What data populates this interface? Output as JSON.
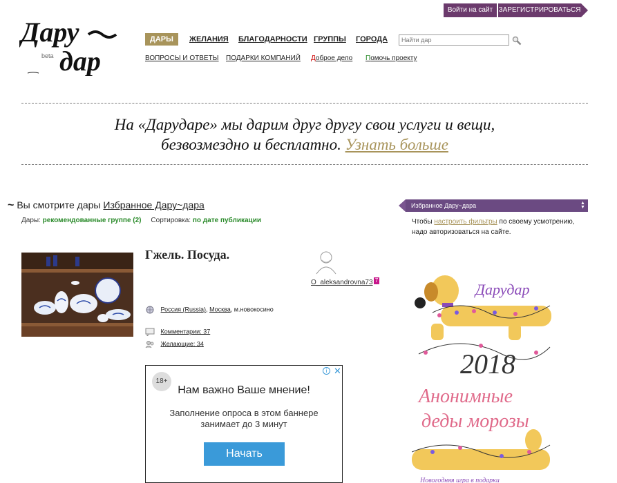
{
  "auth": {
    "login": "Войти на сайт",
    "register": "ЗАРЕГИСТРИРОВАТЬСЯ"
  },
  "logo": {
    "line1": "Дару",
    "line2": "дар",
    "beta": "beta"
  },
  "nav": {
    "primary": [
      "ДАРЫ",
      "ЖЕЛАНИЯ",
      "БЛАГОДАРНОСТИ",
      "ГРУППЫ",
      "ГОРОДА"
    ],
    "secondary": [
      "ВОПРОСЫ И ОТВЕТЫ",
      "ПОДАРКИ КОМПАНИЙ"
    ],
    "good_deed": {
      "first": "Д",
      "rest": "оброе дело"
    },
    "help": {
      "first": "П",
      "rest": "омочь проекту"
    }
  },
  "search": {
    "placeholder": "Найти дар"
  },
  "tagline": {
    "text_line1": "На «Дарударе» мы дарим друг другу свои услуги и вещи,",
    "text_line2": "безвозмездно и бесплатно.",
    "more": "Узнать больше"
  },
  "viewing": {
    "prefix": "Вы смотрите дары",
    "group": "Избранное Дару~дара"
  },
  "filters": {
    "gifts_label": "Дары:",
    "gifts_value": "рекомендованные группе (2)",
    "sort_label": "Сортировка:",
    "sort_value": "по дате публикации"
  },
  "gift": {
    "title": "Гжель. Посуда.",
    "username": "O_aleksandrovna73",
    "badge": "7",
    "location": {
      "country": "Россия (Russia)",
      "city": "Москва",
      "district": ", м.новокосино"
    },
    "comments": "Комментарии: 37",
    "wishers": "Желающие: 34"
  },
  "ad": {
    "age": "18+",
    "heading": "Нам важно Ваше мнение!",
    "text1": "Заполнение опроса в этом баннере",
    "text2": "занимает до 3 минут",
    "button": "Начать"
  },
  "sidebar": {
    "select": "Избранное Дару~дара",
    "note_pre": "Чтобы ",
    "note_link": "настроить фильтры",
    "note_post": " по своему усмотрению, надо авторизоваться на сайте."
  },
  "promo": {
    "brand": "Дарудар",
    "year": "2018",
    "title1": "Анонимные",
    "title2": "деды морозы",
    "footer": "Новогодняя игра в подарки"
  },
  "colors": {
    "purple": "#6b3a6c",
    "gold": "#a8945b",
    "green": "#2a8a2a",
    "blue": "#3a9ad9"
  }
}
